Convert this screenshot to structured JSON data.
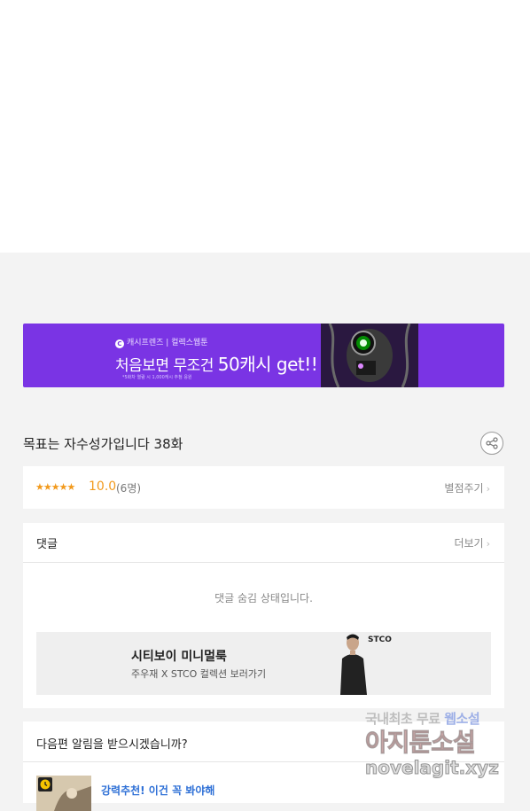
{
  "banner": {
    "brand": "캐시프렌즈 | 컬렉스웹툰",
    "brand_logo": "C",
    "headline_prefix": "처음보면 무조건 ",
    "headline_big": "50캐시 get!!",
    "note": "*5화차 열람 시 1,000캐시 추첨 응원",
    "color": "#7a34e4"
  },
  "episode": {
    "title": "목표는 자수성가입니다 38화"
  },
  "rating": {
    "stars": "★★★★★",
    "score": "10.0",
    "count": "(6명)",
    "rate_label": "별점주기"
  },
  "comments": {
    "title": "댓글",
    "more_label": "더보기",
    "hidden_message": "댓글 숨김 상태입니다."
  },
  "ad": {
    "title": "시티보이 미니멀룩",
    "subtitle": "주우재 X STCO 컬렉션 보러가기",
    "logo": "STCO"
  },
  "notify": {
    "title": "다음편 알림을 받으시겠습니까?",
    "recommendation": "강력추천! 이건 꼭 봐야해"
  },
  "watermark": {
    "line1_prefix": "국내최초 무료 ",
    "line1_highlight": "웹소설",
    "line2": "아지툰소설",
    "line3": "novelagit.xyz"
  },
  "colors": {
    "accent_orange": "#f29a1d",
    "link_blue": "#2d6fd6"
  }
}
